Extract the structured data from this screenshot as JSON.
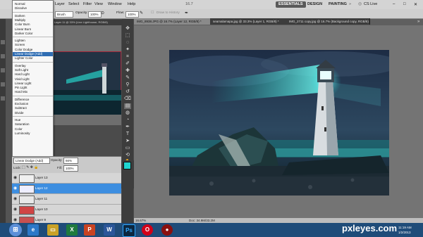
{
  "menubar": {
    "items": [
      "Layer",
      "Select",
      "Filter",
      "View",
      "Window",
      "Help"
    ],
    "zoom": "16.7",
    "workspaces": [
      "ESSENTIALS",
      "DESIGN",
      "PAINTING"
    ],
    "cslive": "CS Live"
  },
  "toolbar": {
    "brush_label": "Brush",
    "opacity_label": "Opacity:",
    "opacity_value": "100%",
    "flow_label": "Flow:",
    "flow_value": "100%",
    "history_label": "Draw to History"
  },
  "blend_modes": {
    "groups": [
      [
        "Normal",
        "Dissolve"
      ],
      [
        "Darken",
        "Multiply",
        "Color Burn",
        "Linear Burn",
        "Darker Color"
      ],
      [
        "Lighten",
        "Screen",
        "Color Dodge",
        "Linear Dodge (Add)",
        "Lighter Color"
      ],
      [
        "Overlay",
        "Soft Light",
        "Hard Light",
        "Vivid Light",
        "Linear Light",
        "Pin Light",
        "Hard Mix"
      ],
      [
        "Difference",
        "Exclusion",
        "Subtract",
        "Divide"
      ],
      [
        "Hue",
        "Saturation",
        "Color",
        "Luminosity"
      ]
    ],
    "selected": "Linear Dodge (Add)"
  },
  "tabs": [
    "IMG_8938.JPG @ 16.7% (Layer 12, RGB/8) *",
    "seamalamapa.jpg @ 33.3% (Layer 1, RGB/8) *",
    "IMG_2711 copy.jpg @ 16.7% (Background copy, RGB/8) *"
  ],
  "doc2_tab": "Layer 11 @ 33% (Line Lighthouse, RGB/8)",
  "layers_panel": {
    "blend_value": "Linear Dodge (Add)",
    "opacity_label": "Opacity:",
    "opacity_value": "66%",
    "fill_label": "Fill:",
    "fill_value": "100%",
    "lock_label": "Lock:",
    "rows": [
      "Layer 13",
      "Layer 12",
      "Layer 11",
      "Layer 10",
      "Layer 9"
    ],
    "selected": "Layer 12"
  },
  "status": {
    "zoom": "16.67%",
    "doc": "Doc: 34.9M/33.2M"
  },
  "taskbar": {
    "time": "11:19 AM",
    "date": "1/2/2013"
  },
  "watermark": "pxleyes.com"
}
